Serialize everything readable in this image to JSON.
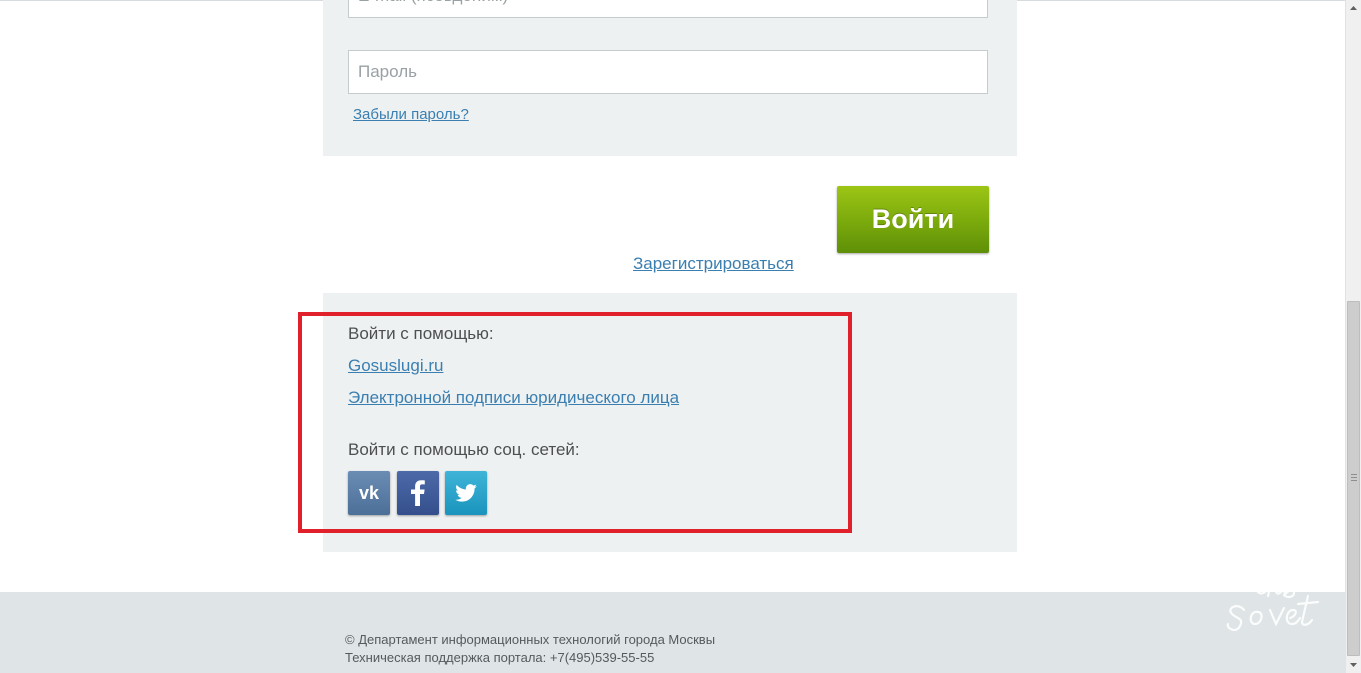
{
  "login_form": {
    "login_placeholder": "E-mail (псевдоним)",
    "password_placeholder": "Пароль",
    "forgot_password": "Забыли пароль?",
    "submit_label": "Войти",
    "register_link": "Зарегистрироваться"
  },
  "alt_login": {
    "title": "Войти с помощью:",
    "links": [
      "Gosuslugi.ru",
      "Электронной подписи юридического лица"
    ],
    "social_title": "Войти с помощью соц. сетей:",
    "social_icons": [
      "vk-icon",
      "facebook-icon",
      "twitter-icon"
    ],
    "highlight_color": "#e0202a"
  },
  "footer": {
    "copyright": "© Департамент информационных технологий города Москвы",
    "support": "Техническая поддержка портала: +7(495)539-55-55"
  },
  "colors": {
    "panel_bg": "#eef1f2",
    "footer_bg": "#dfe4e6",
    "link": "#3a7fb0",
    "submit_green": "#7aa90c",
    "vk": "#4c6f98",
    "facebook": "#344f8c",
    "twitter": "#1a94bd"
  }
}
